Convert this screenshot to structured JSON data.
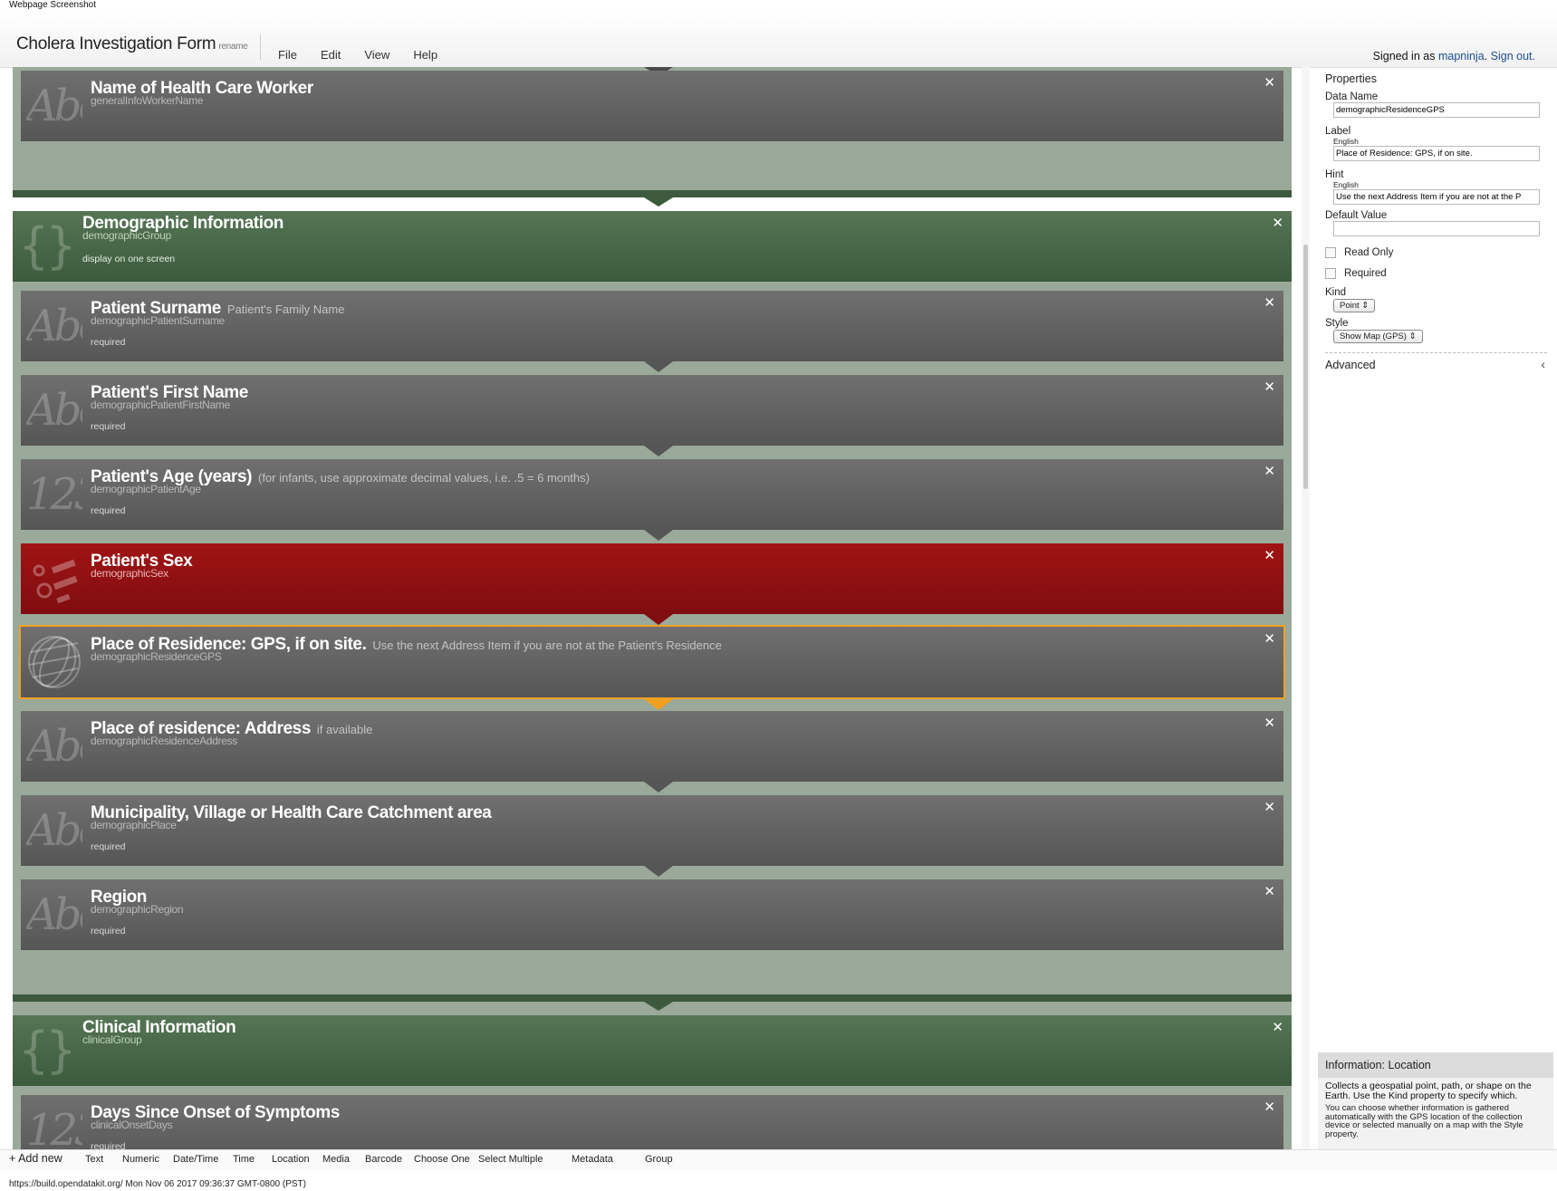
{
  "caption": "Webpage Screenshot",
  "app": {
    "title": "Cholera Investigation Form",
    "rename": "rename",
    "menu": [
      "File",
      "Edit",
      "View",
      "Help"
    ],
    "signed_in_prefix": "Signed in as",
    "user": "mapninja",
    "dot": ".",
    "sign_out": "Sign out."
  },
  "form": {
    "worker": {
      "title": "Name of Health Care Worker",
      "data_name": "generalInfoWorkerName"
    },
    "demographic_group": {
      "title": "Demographic Information",
      "data_name": "demographicGroup",
      "note": "display on one screen"
    },
    "surname": {
      "title": "Patient Surname",
      "hint": "Patient's Family Name",
      "data_name": "demographicPatientSurname",
      "note": "required"
    },
    "first_name": {
      "title": "Patient's First Name",
      "data_name": "demographicPatientFirstName",
      "note": "required"
    },
    "age": {
      "title": "Patient's Age (years)",
      "hint": "(for infants, use approximate decimal values, i.e. .5 = 6 months)",
      "data_name": "demographicPatientAge",
      "note": "required"
    },
    "sex": {
      "title": "Patient's Sex",
      "data_name": "demographicSex"
    },
    "gps": {
      "title": "Place of Residence: GPS, if on site.",
      "hint": "Use the next Address Item if you are not at the Patient's Residence",
      "data_name": "demographicResidenceGPS"
    },
    "address": {
      "title": "Place of residence: Address",
      "hint": "if available",
      "data_name": "demographicResidenceAddress"
    },
    "place": {
      "title": "Municipality, Village or Health Care Catchment area",
      "data_name": "demographicPlace",
      "note": "required"
    },
    "region": {
      "title": "Region",
      "data_name": "demographicRegion",
      "note": "required"
    },
    "clinical_group": {
      "title": "Clinical Information",
      "data_name": "clinicalGroup"
    },
    "onset": {
      "title": "Days Since Onset of Symptoms",
      "data_name": "clinicalOnsetDays",
      "note": "required"
    },
    "close_glyph": "✕"
  },
  "properties": {
    "heading": "Properties",
    "data_name_label": "Data Name",
    "data_name_value": "demographicResidenceGPS",
    "label_label": "Label",
    "label_lang": "English",
    "label_value": "Place of Residence: GPS, if on site.",
    "hint_label": "Hint",
    "hint_lang": "English",
    "hint_value": "Use the next Address Item if you are not at the P",
    "default_label": "Default Value",
    "default_value": "",
    "read_only": "Read Only",
    "required": "Required",
    "kind_label": "Kind",
    "kind_value": "Point",
    "style_label": "Style",
    "style_value": "Show Map (GPS)",
    "advanced": "Advanced"
  },
  "info": {
    "heading": "Information: Location",
    "p1": "Collects a geospatial point, path, or shape on the Earth. Use the Kind property to specify which.",
    "p2": "You can choose whether information is gathered automatically with the GPS location of the collection device or selected manually on a map with the Style property."
  },
  "palette": {
    "add_new": "+ Add new",
    "items": [
      "Text",
      "Numeric",
      "Date/Time",
      "Time",
      "Location",
      "Media",
      "Barcode",
      "Choose One",
      "Select Multiple",
      "Metadata",
      "Group"
    ]
  },
  "status": "https://build.opendatakit.org/ Mon Nov 06 2017 09:36:37 GMT-0800 (PST)",
  "colors": {
    "group": "#3e5a3e",
    "item": "#606060",
    "selected_item": "#8b0f12",
    "selection_outline": "#f0a020"
  }
}
